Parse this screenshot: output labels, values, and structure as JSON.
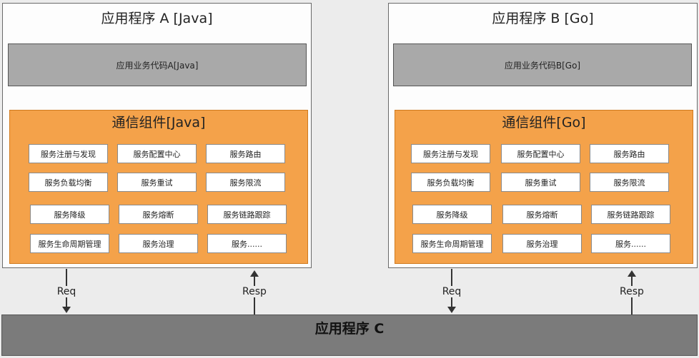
{
  "app_a": {
    "title": "应用程序 A [Java]",
    "business": "应用业务代码A[Java]",
    "comm_title": "通信组件[Java]",
    "services": [
      "服务注册与发现",
      "服务配置中心",
      "服务路由",
      "服务负载均衡",
      "服务重试",
      "服务限流",
      "服务降级",
      "服务熔断",
      "服务链路跟踪",
      "服务生命周期管理",
      "服务治理",
      "服务......"
    ]
  },
  "app_b": {
    "title": "应用程序 B [Go]",
    "business": "应用业务代码B[Go]",
    "comm_title": "通信组件[Go]",
    "services": [
      "服务注册与发现",
      "服务配置中心",
      "服务路由",
      "服务负载均衡",
      "服务重试",
      "服务限流",
      "服务降级",
      "服务熔断",
      "服务链路跟踪",
      "服务生命周期管理",
      "服务治理",
      "服务......"
    ]
  },
  "arrows": {
    "req": "Req",
    "resp": "Resp"
  },
  "app_c": {
    "title": "应用程序 C"
  }
}
